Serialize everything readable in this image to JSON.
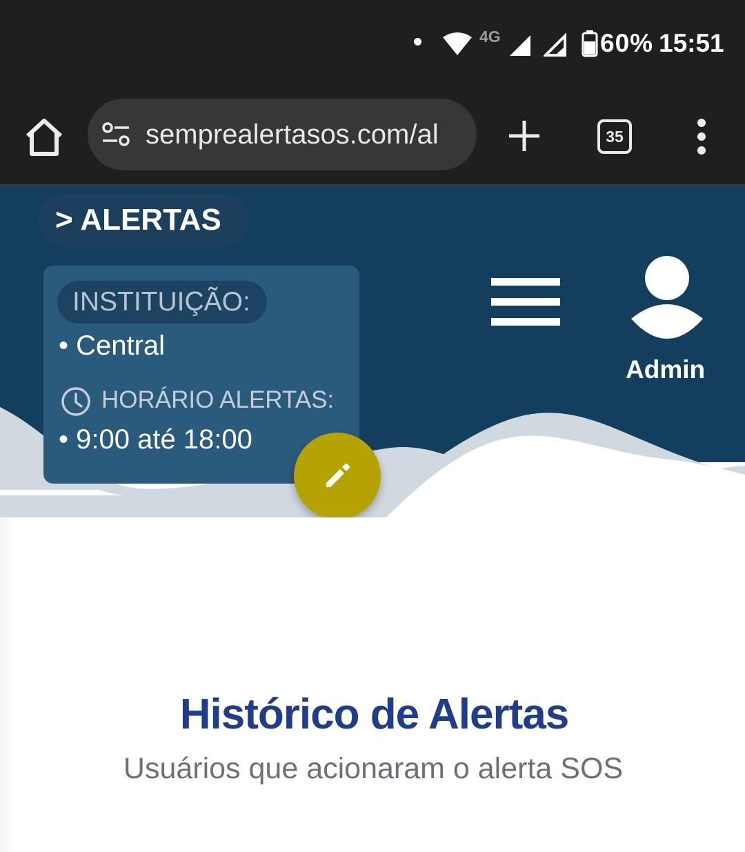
{
  "status_bar": {
    "network": "4G",
    "battery": "60%",
    "time": "15:51",
    "icons": [
      "notification-dot-icon",
      "wifi-icon",
      "signal-icon",
      "signal-icon",
      "battery-icon"
    ]
  },
  "browser": {
    "url": "semprealertasos.com/al",
    "tab_count": "35",
    "icons": [
      "home-icon",
      "site-settings-icon",
      "plus-icon",
      "more-vert-icon"
    ]
  },
  "header": {
    "breadcrumb": "> ALERTAS",
    "institution_label": "INSTITUIÇÃO:",
    "institution_value": "• Central",
    "hours_label": "HORÁRIO ALERTAS:",
    "hours_value": "• 9:00 até 18:00",
    "user_name": "Admin",
    "icons": [
      "clock-icon",
      "hamburger-menu-icon",
      "user-avatar-icon",
      "pencil-icon"
    ]
  },
  "main": {
    "title": "Histórico de Alertas",
    "subtitle": "Usuários que acionaram o alerta SOS"
  },
  "colors": {
    "header_bg": "#133e5d",
    "wave_light": "#d1d9e0",
    "card_bg": "#2a5a7c",
    "fab": "#b5a203",
    "title": "#1f3d8a",
    "subtitle": "#6b7079"
  }
}
